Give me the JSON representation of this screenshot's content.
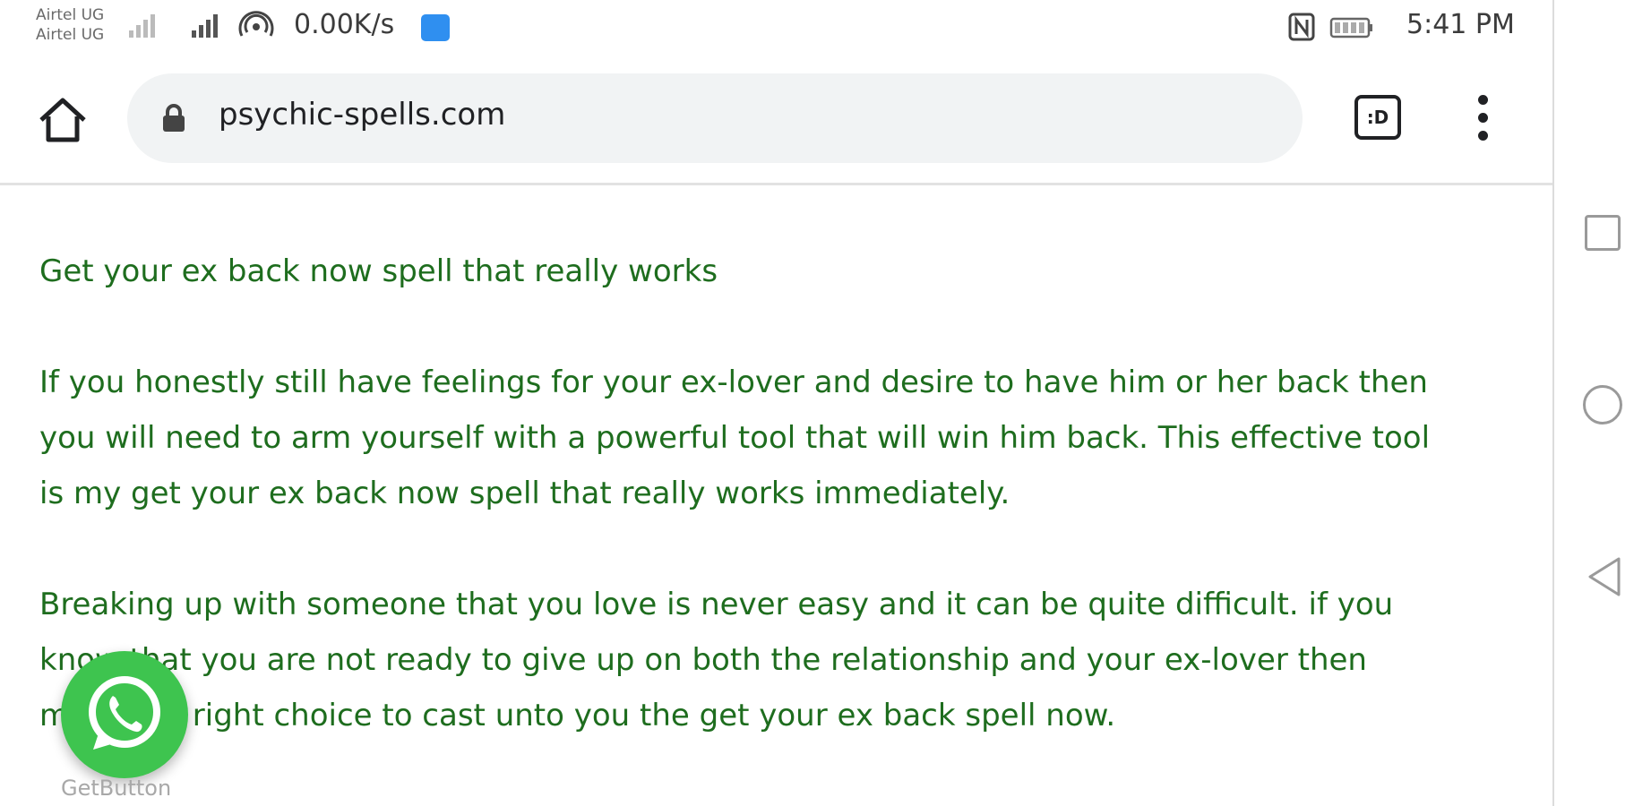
{
  "status_bar": {
    "carrier_1": "Airtel UG",
    "carrier_2": "Airtel UG",
    "net_speed": "0.00K/s",
    "time": "5:41 PM"
  },
  "browser": {
    "url": "psychic-spells.com",
    "tab_count": ":D",
    "icons": [
      "home-icon",
      "lock-icon",
      "tab-switcher-icon",
      "more-vert-icon"
    ]
  },
  "content": {
    "heading": "Get your ex back now spell that really works",
    "paragraph_1_lines": [
      "If you honestly still have feelings for your ex-lover and desire to have him or her back then",
      "you will need to arm yourself with a powerful tool that will win him back. This effective tool",
      "is my get your ex back now spell that really works immediately."
    ],
    "paragraph_2_lines": [
      "Breaking up with someone that you love is never easy and it can be quite difficult. if you",
      "know that you are not ready to give up on both the relationship and your ex-lover then",
      "make the right choice  to cast unto you the get your ex back spell now."
    ]
  },
  "floating": {
    "getbutton_label": "GetButton",
    "whatsapp_color": "#3ec44f"
  },
  "colors": {
    "text_green": "#1e6d1e",
    "url_bar_bg": "#f1f3f4"
  }
}
